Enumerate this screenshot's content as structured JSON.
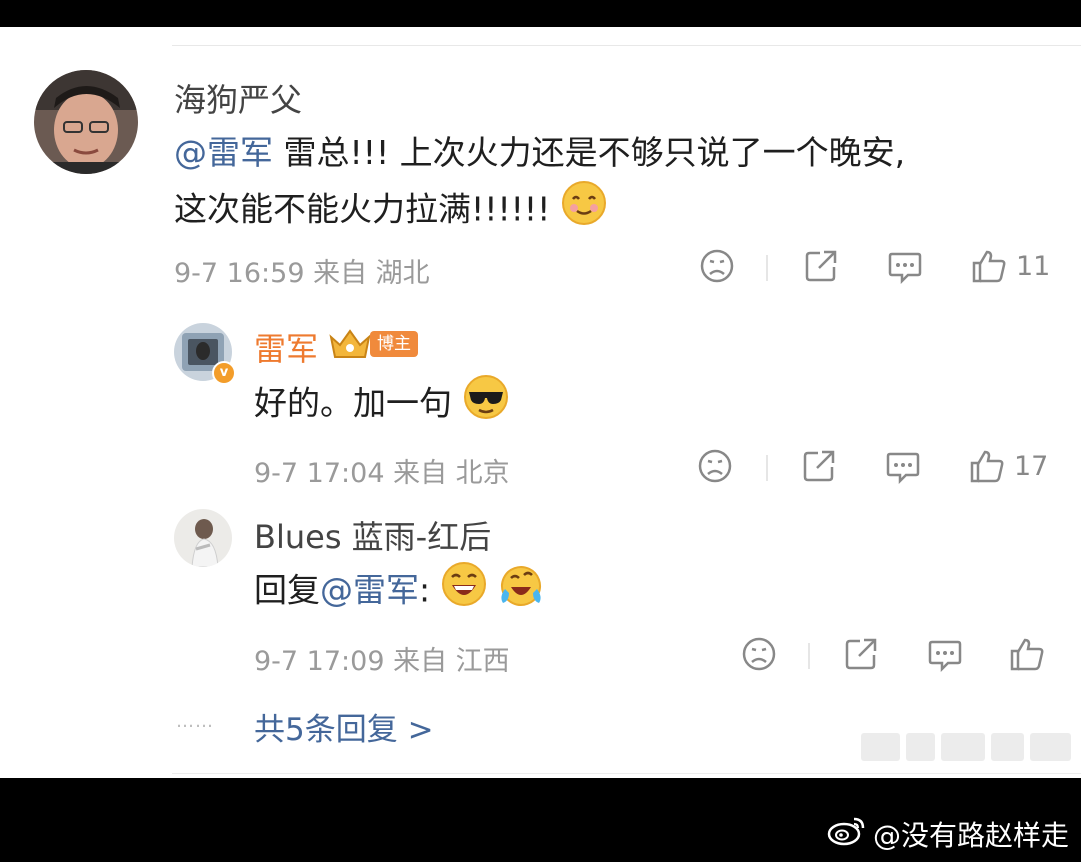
{
  "comment": {
    "author": "海狗严父",
    "mention": "@雷军",
    "text_line1": " 雷总!!! 上次火力还是不够只说了一个晚安,",
    "text_line2": "这次能不能火力拉满!!!!!! ",
    "time": "9-7 16:59",
    "location": "来自 湖北",
    "likes": "11"
  },
  "replies": [
    {
      "author": "雷军",
      "badge": "博主",
      "verified": "v",
      "text": "好的。加一句",
      "time": "9-7 17:04",
      "location": "来自 北京",
      "likes": "17"
    },
    {
      "author": "Blues 蓝雨-红后",
      "prefix": "回复",
      "mention": "@雷军",
      "suffix": ":",
      "time": "9-7 17:09",
      "location": "来自 江西",
      "likes": ""
    }
  ],
  "more_replies": "共5条回复 >",
  "more_dots": "……",
  "watermark": "@没有路赵样走",
  "icons": [
    "frown-icon",
    "share-icon",
    "comment-icon",
    "like-icon",
    "weibo-logo-icon"
  ],
  "colors": {
    "mention": "#44679a",
    "vip_name": "#ee7a2f",
    "meta": "#9a9a9a"
  }
}
